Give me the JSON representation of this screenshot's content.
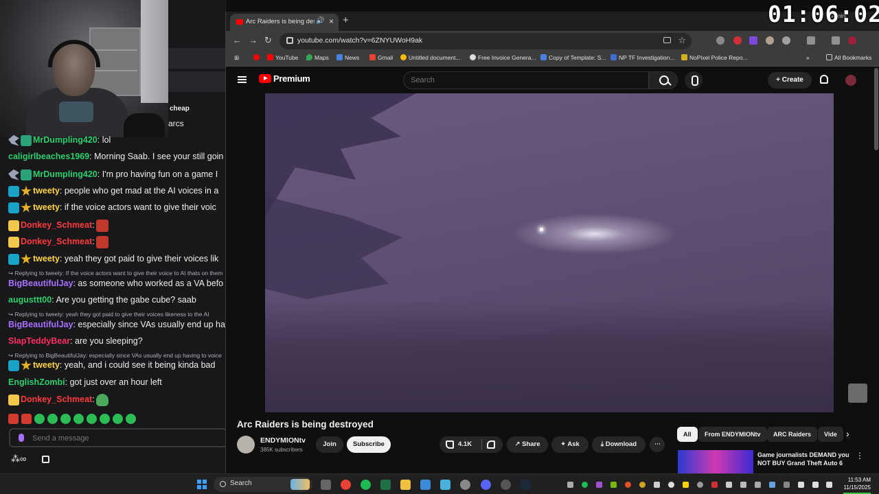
{
  "timer": "01:06:02",
  "chat": {
    "prev_snippets": [
      "cheap",
      "arcs"
    ],
    "messages": [
      {
        "user": "MrDumpling420",
        "color": "#2bcf6b",
        "text": ": lol",
        "badges": [
          "bird",
          "mod"
        ]
      },
      {
        "user": "caligirlbeaches1969",
        "color": "#2bcf6b",
        "text": ": Morning Saab. I see your still goin",
        "badges": []
      },
      {
        "user": "MrDumpling420",
        "color": "#2bcf6b",
        "text": ": I'm pro having fun on a game I",
        "badges": [
          "bird",
          "mod"
        ]
      },
      {
        "user": "tweety",
        "color": "#ffd447",
        "text": ": people who get mad at the AI voices in a",
        "badges": [
          "tier",
          "star"
        ]
      },
      {
        "user": "tweety",
        "color": "#ffd447",
        "text": ": if the voice actors want to give their voic",
        "badges": [
          "tier",
          "star"
        ]
      },
      {
        "user": "Donkey_Schmeat",
        "color": "#ff3a3a",
        "text": ":",
        "badges": [
          "duck"
        ],
        "emote": "red"
      },
      {
        "user": "Donkey_Schmeat",
        "color": "#ff3a3a",
        "text": ":",
        "badges": [
          "duck"
        ],
        "emote": "red"
      },
      {
        "user": "tweety",
        "color": "#ffd447",
        "text": ": yeah they got paid to give their voices lik",
        "badges": [
          "tier",
          "star"
        ]
      },
      {
        "user": "BigBeautifulJay",
        "color": "#a970ff",
        "text": ": as someone who worked as a VA befo",
        "badges": []
      },
      {
        "user": "augusttt00",
        "color": "#2bcf6b",
        "text": ": Are you getting the gabe cube? saab",
        "badges": []
      },
      {
        "user": "BigBeautifulJay",
        "color": "#a970ff",
        "text": ": especially since VAs usually end up ha",
        "badges": []
      },
      {
        "user": "SlapTeddyBear",
        "color": "#ff2f5e",
        "text": ": are you sleeping?",
        "badges": []
      },
      {
        "user": "tweety",
        "color": "#ffd447",
        "text": ": yeah, and i could see it being kinda bad",
        "badges": [
          "tier",
          "star"
        ]
      },
      {
        "user": "EnglishZombi",
        "color": "#2bcf6b",
        "text": ": got just over an hour left",
        "badges": []
      },
      {
        "user": "Donkey_Schmeat",
        "color": "#ff3a3a",
        "text": ":",
        "badges": [
          "duck"
        ],
        "emote": "frog"
      }
    ],
    "replies": [
      "↪ Replying to tweety: If the voice actors want to give their voice to AI thats on them",
      "↪ Replying to tweety: yeah they got paid to give their voices likeness to the AI",
      "↪ Replying to BigBeautifulJay: especially since VAs usually end up having to voice"
    ],
    "input_placeholder": "Send a message",
    "points_label": "∞"
  },
  "browser": {
    "tab_title": "Arc Raiders is being destroy",
    "url": "youtube.com/watch?v=6ZNYUWoH9ak",
    "gemini": "Gemini",
    "bookmarks": [
      "YouTube",
      "Maps",
      "News",
      "Gmail",
      "Untitled document...",
      "Free Invoice Genera...",
      "Copy of Template: S...",
      "NP TF Investigation...",
      "NoPixel Police Repo..."
    ],
    "bookmarks_more": "»",
    "all_bookmarks": "All Bookmarks"
  },
  "youtube": {
    "brand": "Premium",
    "search_placeholder": "Search",
    "create_label": "Create",
    "video_title": "Arc Raiders is being destroyed",
    "channel_name": "ENDYMIONtv",
    "subscribers": "385K subscribers",
    "join_label": "Join",
    "subscribe_label": "Subscribe",
    "like_count": "4.1K",
    "share_label": "Share",
    "ask_label": "Ask",
    "download_label": "Download",
    "more_label": "···",
    "chips": [
      "All",
      "From ENDYMIONtv",
      "ARC Raiders",
      "Vide"
    ],
    "rec_title": "Game journalists DEMAND you NOT BUY Grand Theft Auto 6"
  },
  "taskbar": {
    "search_label": "Search",
    "time": "11:53 AM",
    "date": "11/15/2025"
  }
}
